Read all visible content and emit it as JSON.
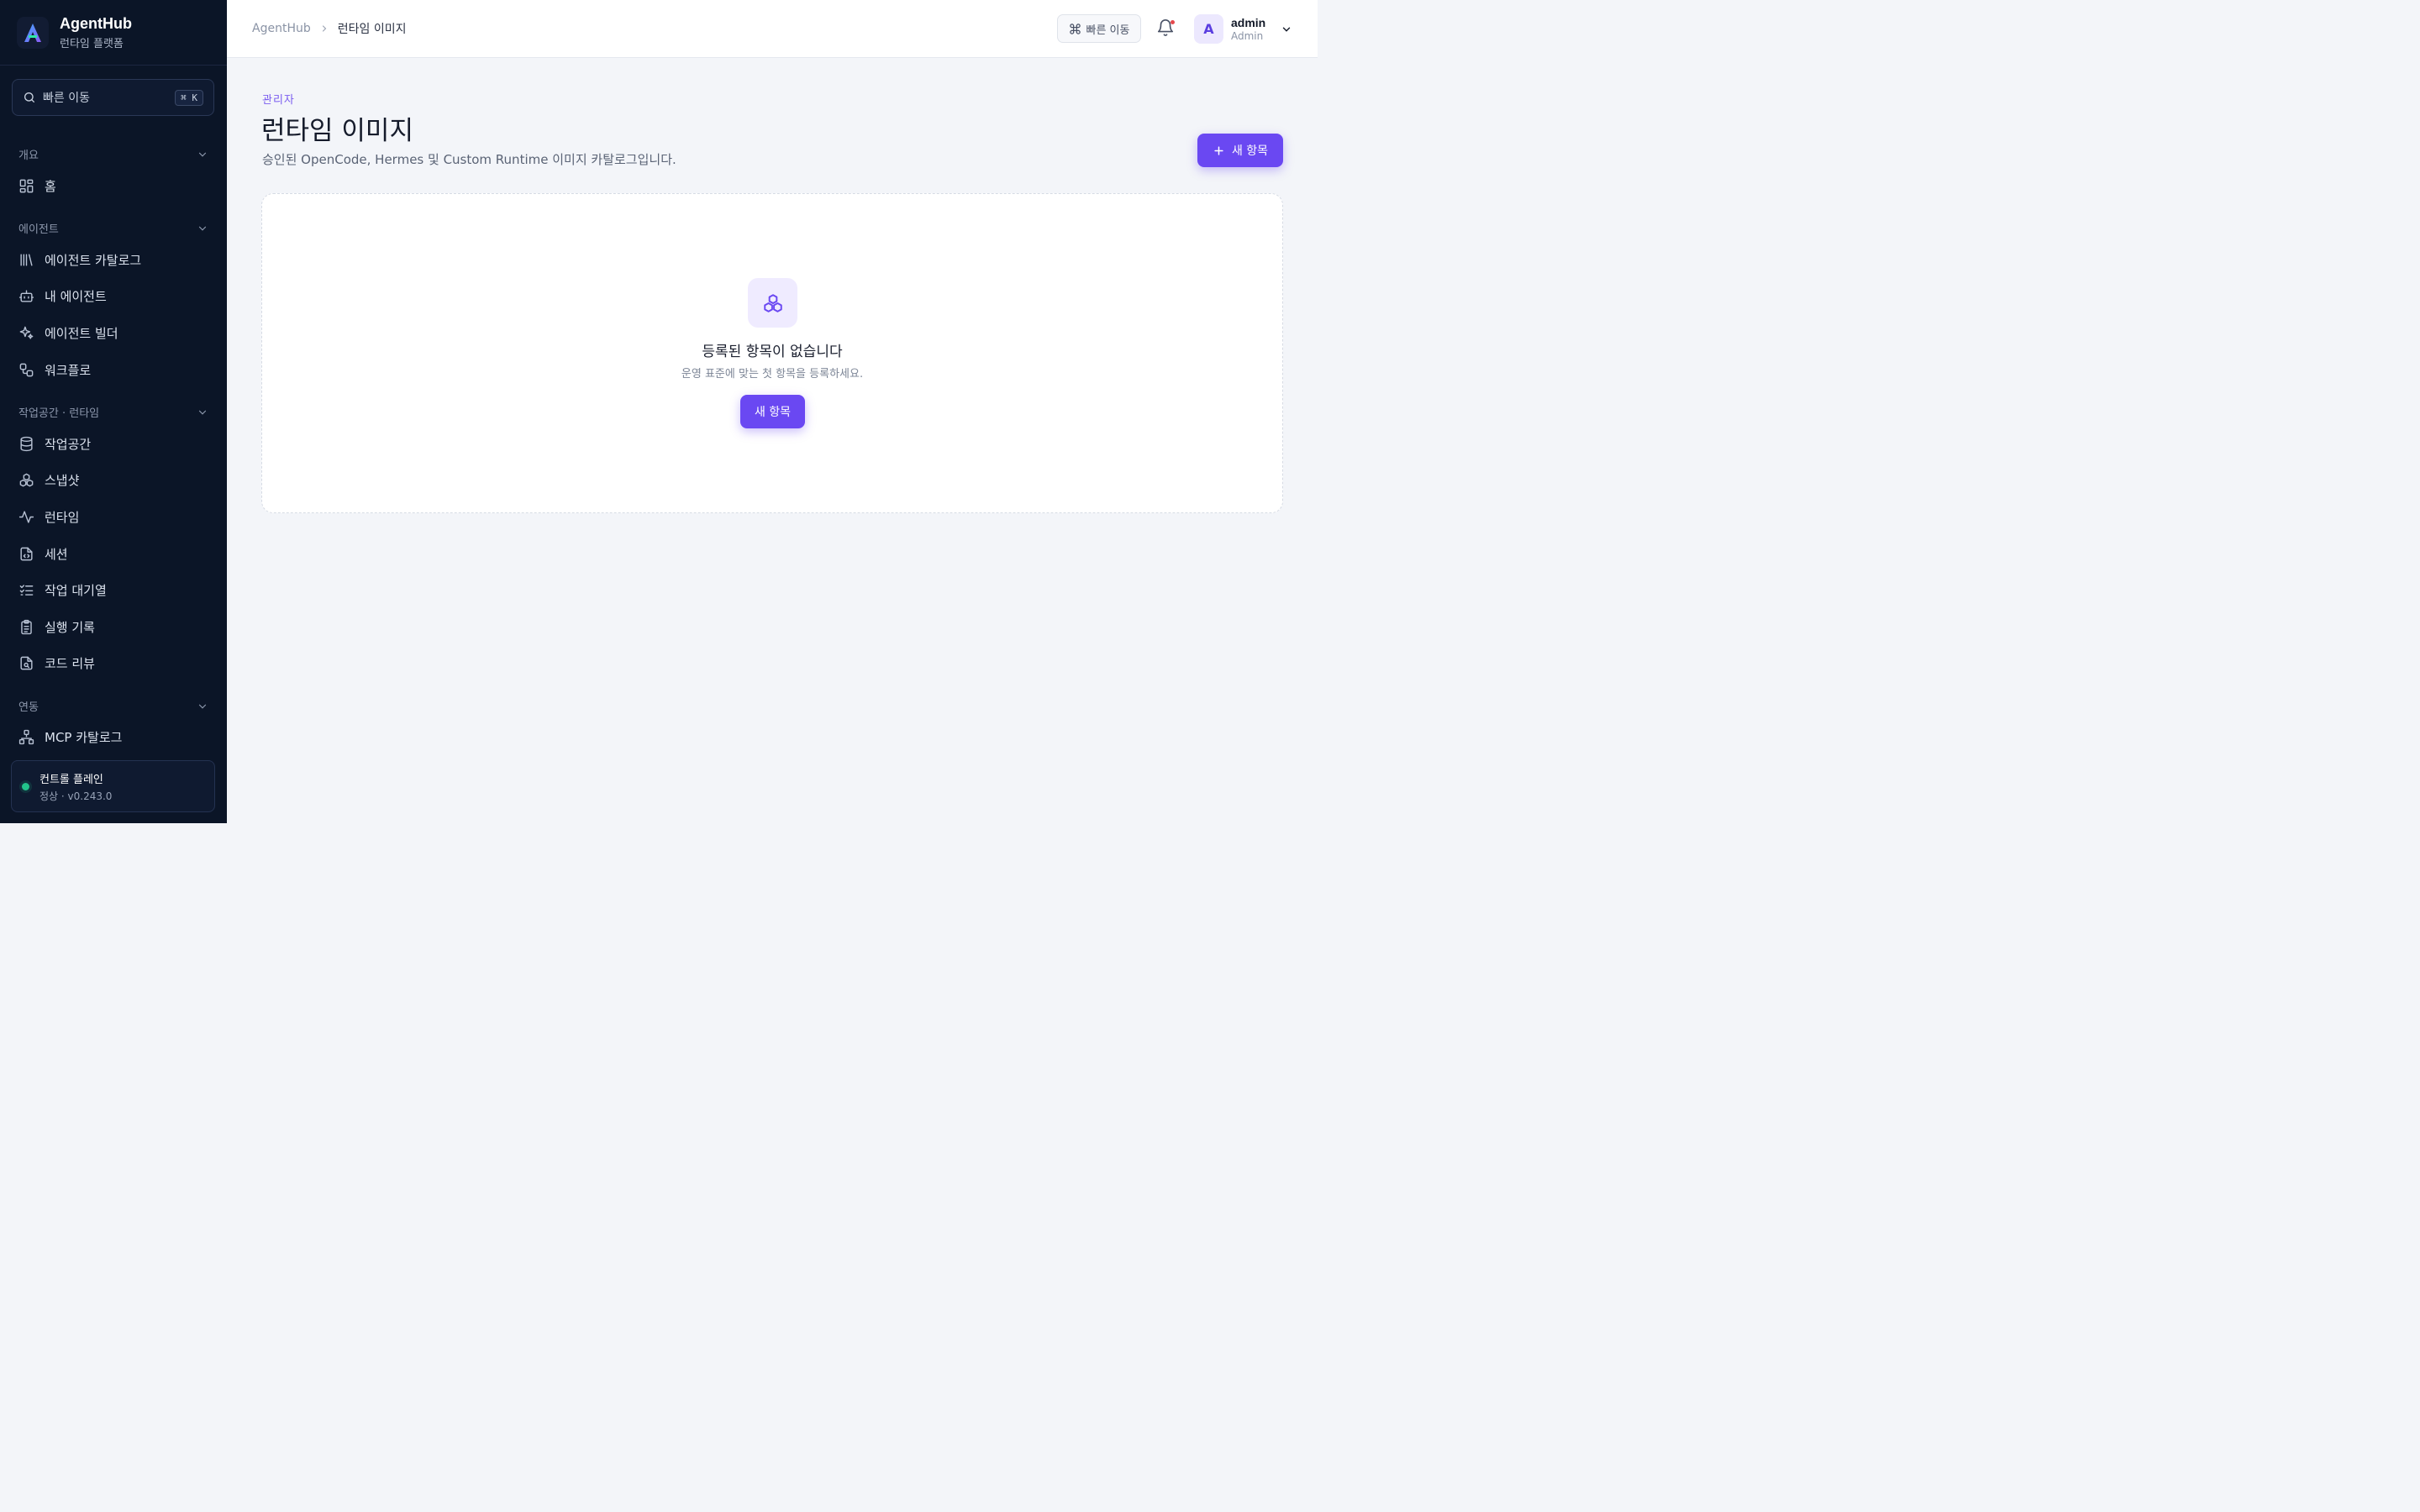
{
  "sidebar": {
    "brand_name": "AgentHub",
    "brand_sub": "런타임 플랫폼",
    "search_label": "빠른 이동",
    "search_shortcut": "⌘ K",
    "sections": [
      {
        "title": "개요",
        "items": [
          {
            "label": "홈",
            "icon": "grid-icon"
          }
        ]
      },
      {
        "title": "에이전트",
        "items": [
          {
            "label": "에이전트 카탈로그",
            "icon": "library-icon"
          },
          {
            "label": "내 에이전트",
            "icon": "bot-icon"
          },
          {
            "label": "에이전트 빌더",
            "icon": "sparkles-icon"
          },
          {
            "label": "워크플로",
            "icon": "workflow-icon"
          }
        ]
      },
      {
        "title": "작업공간 · 런타임",
        "items": [
          {
            "label": "작업공간",
            "icon": "database-icon"
          },
          {
            "label": "스냅샷",
            "icon": "boxes-icon"
          },
          {
            "label": "런타임",
            "icon": "activity-icon"
          },
          {
            "label": "세션",
            "icon": "file-code-icon"
          },
          {
            "label": "작업 대기열",
            "icon": "list-checks-icon"
          },
          {
            "label": "실행 기록",
            "icon": "clipboard-icon"
          },
          {
            "label": "코드 리뷰",
            "icon": "file-search-icon"
          }
        ]
      },
      {
        "title": "연동",
        "items": [
          {
            "label": "MCP 카탈로그",
            "icon": "network-icon"
          }
        ]
      }
    ],
    "status": {
      "title": "컨트롤 플레인",
      "sub": "정상 · v0.243.0",
      "color": "#22c58b"
    }
  },
  "topbar": {
    "breadcrumb_root": "AgentHub",
    "breadcrumb_current": "런타임 이미지",
    "quick_label": "빠른 이동",
    "user": {
      "initial": "A",
      "name": "admin",
      "role": "Admin"
    }
  },
  "main": {
    "eyebrow": "관리자",
    "title": "런타임 이미지",
    "description": "승인된 OpenCode, Hermes 및 Custom Runtime 이미지 카탈로그입니다.",
    "new_button": "새 항목",
    "empty": {
      "title": "등록된 항목이 없습니다",
      "subtitle": "운영 표준에 맞는 첫 항목을 등록하세요.",
      "button": "새 항목",
      "icon": "boxes-icon"
    }
  },
  "colors": {
    "accent": "#6a48f2",
    "sidebar_bg": "#0b1527",
    "page_bg": "#f3f5f9"
  }
}
